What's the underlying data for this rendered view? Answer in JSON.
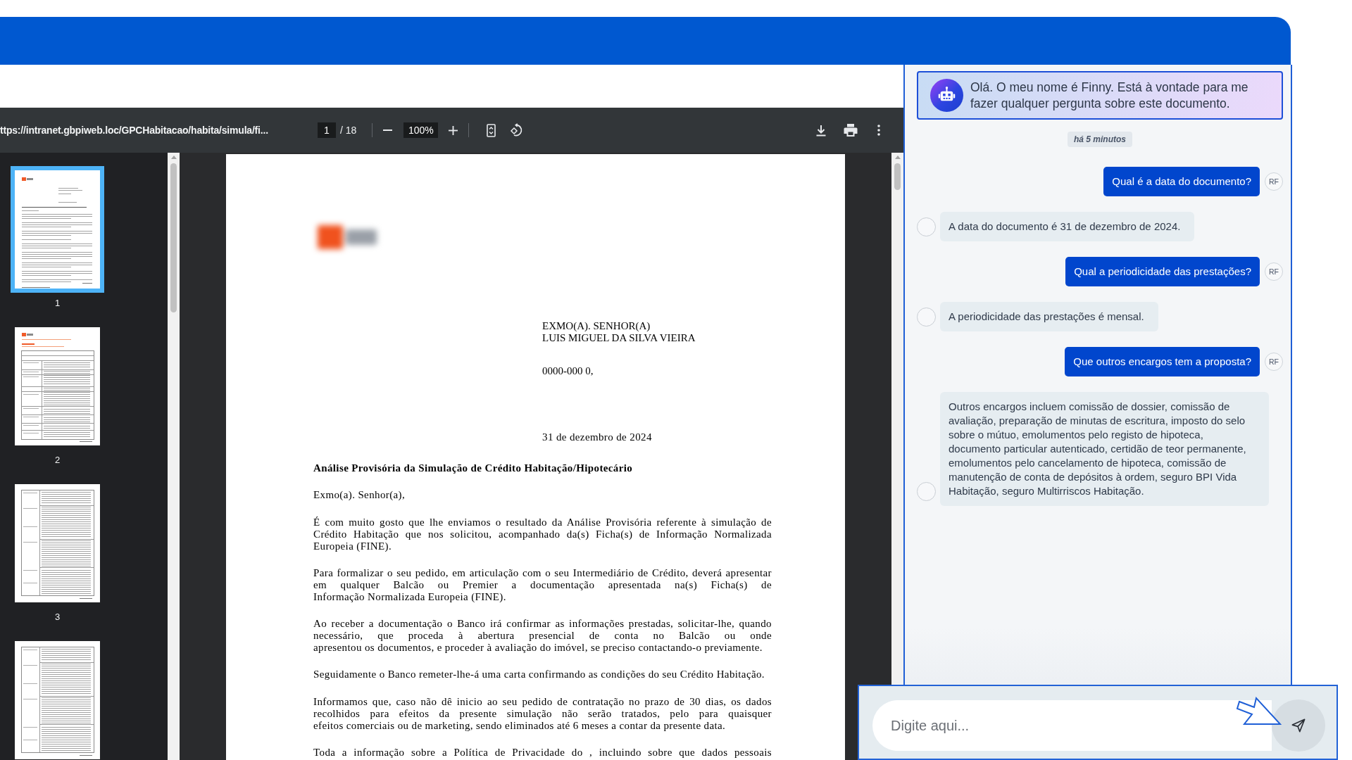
{
  "pdf_viewer": {
    "toolbar": {
      "url": "ttps://intranet.gbpiweb.loc/GPCHabitacao/habita/simula/fi...",
      "page_field": {
        "value": "1"
      },
      "page_total": "/ 18",
      "zoom_field": {
        "value": "100%"
      }
    },
    "thumbnails": [
      {
        "label": "1",
        "selected": true,
        "kind": "letter"
      },
      {
        "label": "2",
        "selected": false,
        "kind": "table-with-heading"
      },
      {
        "label": "3",
        "selected": false,
        "kind": "table"
      },
      {
        "selected": false,
        "kind": "table"
      }
    ],
    "page": {
      "recipient": [
        "EXMO(A). SENHOR(A)",
        "LUIS MIGUEL DA SILVA VIEIRA"
      ],
      "postal_code": "0000-000 0,",
      "date": "31 de dezembro de 2024",
      "title": "Análise Provisória da Simulação de Crédito Habitação/Hipotecário",
      "greeting": "Exmo(a). Senhor(a),",
      "paragraphs": [
        {
          "continues": false,
          "lines": [
            "É com muito gosto que lhe enviamos o resultado da Análise Provisória referente à simulação de",
            "Crédito Habitação que nos solicitou, acompanhado da(s) Ficha(s) de Informação Normalizada",
            "Europeia (FINE)."
          ]
        },
        {
          "continues": false,
          "lines": [
            "Para formalizar o seu pedido, em articulação com o seu Intermediário de Crédito, deverá apresentar",
            "em qualquer Balcão ou Premier a documentação apresentada na(s) Ficha(s) de",
            "Informação Normalizada Europeia (FINE)."
          ]
        },
        {
          "continues": false,
          "lines": [
            "Ao receber a documentação o Banco irá confirmar as informações prestadas, solicitar-lhe, quando",
            "necessário, que proceda à abertura presencial de conta no Balcão ou onde",
            "apresentou os documentos, e proceder à avaliação do imóvel, se preciso contactando-o previamente."
          ]
        },
        {
          "continues": false,
          "lines": [
            "Seguidamente o Banco remeter-lhe-á uma carta confirmando as condições do seu Crédito Habitação."
          ]
        },
        {
          "continues": false,
          "lines": [
            "Informamos que, caso não dê inicio ao seu pedido de contratação no prazo de 30 dias, os dados",
            "recolhidos para efeitos da presente simulação não serão tratados, pelo para quaisquer",
            "efeitos comerciais ou de marketing, sendo eliminados até 6 meses a contar da presente data."
          ]
        },
        {
          "continues": true,
          "lines": [
            "Toda a informação sobre a Política de Privacidade do , incluindo sobre que dados pessoais"
          ]
        }
      ]
    }
  },
  "chat": {
    "welcome": "Olá. O meu nome é Finny. Está à vontade para me fazer qualquer pergunta sobre este documento.",
    "timestamp": "há 5 minutos",
    "messages": [
      {
        "kind": "user",
        "text": "Qual é a data do documento?",
        "avatar": "RF"
      },
      {
        "kind": "bot",
        "text": "A data do documento é 31 de dezembro de 2024."
      },
      {
        "kind": "user",
        "text": "Qual a periodicidade das prestações?",
        "avatar": "RF"
      },
      {
        "kind": "bot",
        "text": "A periodicidade das prestações é mensal."
      },
      {
        "kind": "user",
        "text": "Que outros encargos tem a proposta?",
        "avatar": "RF"
      },
      {
        "kind": "bot",
        "text": "Outros encargos incluem comissão de dossier, comissão de avaliação, preparação de minutas de escritura, imposto do selo sobre o mútuo, emolumentos pelo registo de hipoteca, documento particular autenticado, certidão de teor permanente, emolumentos pelo cancelamento de hipoteca, comissão de manutenção de conta de depósitos à ordem, seguro BPI Vida Habitação, seguro Multirriscos Habitação."
      }
    ],
    "input": {
      "placeholder": "Digite aqui..."
    }
  }
}
